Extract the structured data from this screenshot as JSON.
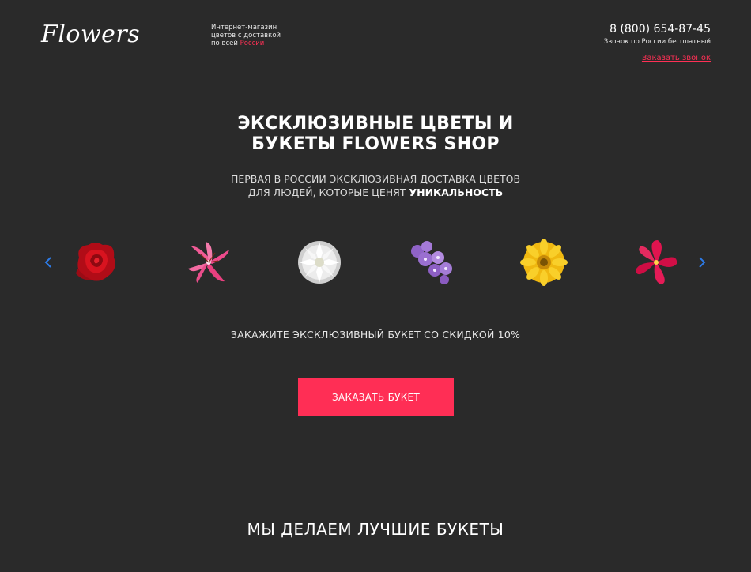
{
  "header": {
    "logo": "Flowers",
    "tagline_line1": "Интернет-магазин",
    "tagline_line2": "цветов с доставкой",
    "tagline_line3_prefix": "по всей",
    "tagline_line3_accent": "России",
    "phone": "8 (800) 654-87-45",
    "phone_note": "Звонок по России бесплатный",
    "callback_link": "Заказать звонок"
  },
  "hero": {
    "title_line1": "ЭКСКЛЮЗИВНЫЕ ЦВЕТЫ И",
    "title_line2": "БУКЕТЫ FLOWERS SHOP",
    "subtitle_line1": "ПЕРВАЯ В РОССИИ ЭКСКЛЮЗИВНАЯ ДОСТАВКА ЦВЕТОВ",
    "subtitle_line2_prefix": "ДЛЯ ЛЮДЕЙ, КОТОРЫЕ ЦЕНЯТ",
    "subtitle_line2_bold": "УНИКАЛЬНОСТЬ"
  },
  "carousel": {
    "prev_icon": "chevron-left-icon",
    "next_icon": "chevron-right-icon",
    "items": [
      {
        "name": "red-rose",
        "color": "#c8101c"
      },
      {
        "name": "pink-lily",
        "color": "#ee4a8c"
      },
      {
        "name": "white-chrysanthemum",
        "color": "#f2f2f2"
      },
      {
        "name": "lilac-phlox",
        "color": "#9a6fd0"
      },
      {
        "name": "yellow-gerbera",
        "color": "#f7c51e"
      },
      {
        "name": "crimson-alstroemeria",
        "color": "#e0144f"
      }
    ]
  },
  "offer": {
    "text": "ЗАКАЖИТЕ ЭКСКЛЮЗИВНЫЙ БУКЕТ СО СКИДКОЙ 10%",
    "button_label": "ЗАКАЗАТЬ БУКЕТ"
  },
  "section": {
    "title": "МЫ ДЕЛАЕМ ЛУЧШИЕ БУКЕТЫ"
  },
  "colors": {
    "background": "#2a2a2a",
    "accent": "#ff2e55",
    "arrow": "#2d7be8"
  }
}
